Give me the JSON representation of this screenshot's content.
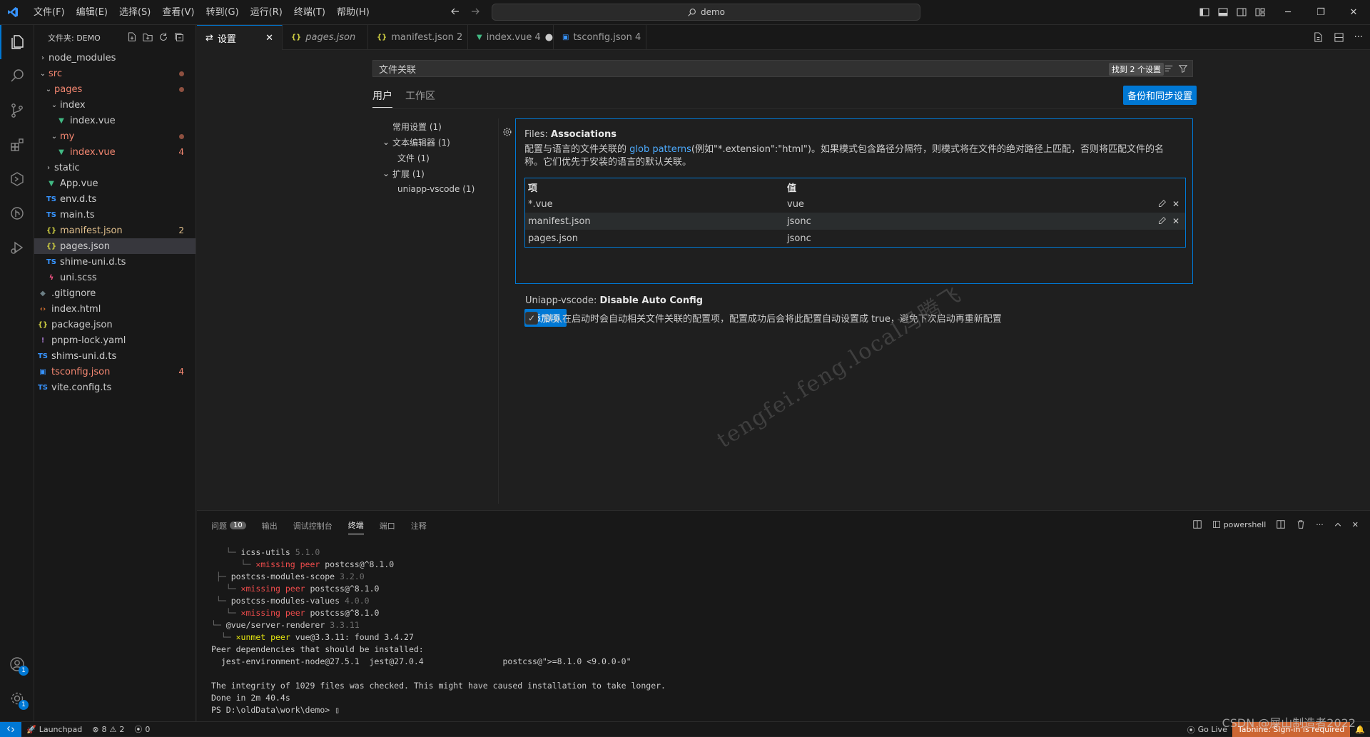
{
  "titlebar": {
    "menus": [
      "文件(F)",
      "编辑(E)",
      "选择(S)",
      "查看(V)",
      "转到(G)",
      "运行(R)",
      "终端(T)",
      "帮助(H)"
    ],
    "search_text": "demo"
  },
  "explorer": {
    "title": "文件夹: DEMO",
    "items": [
      {
        "label": "node_modules"
      },
      {
        "label": "src",
        "badge": ""
      },
      {
        "label": "pages"
      },
      {
        "label": "index"
      },
      {
        "label": "index.vue"
      },
      {
        "label": "my"
      },
      {
        "label": "index.vue",
        "badge": "4"
      },
      {
        "label": "static"
      },
      {
        "label": "App.vue"
      },
      {
        "label": "env.d.ts"
      },
      {
        "label": "main.ts"
      },
      {
        "label": "manifest.json",
        "badge": "2"
      },
      {
        "label": "pages.json"
      },
      {
        "label": "shime-uni.d.ts"
      },
      {
        "label": "uni.scss"
      },
      {
        "label": ".gitignore"
      },
      {
        "label": "index.html"
      },
      {
        "label": "package.json"
      },
      {
        "label": "pnpm-lock.yaml"
      },
      {
        "label": "shims-uni.d.ts"
      },
      {
        "label": "tsconfig.json",
        "badge": "4"
      },
      {
        "label": "vite.config.ts"
      }
    ]
  },
  "tabs": [
    {
      "label": "设置"
    },
    {
      "label": "pages.json"
    },
    {
      "label": "manifest.json 2"
    },
    {
      "label": "index.vue 4"
    },
    {
      "label": "tsconfig.json 4"
    }
  ],
  "settings": {
    "search_value": "文件关联",
    "search_count": "找到 2 个设置",
    "scope_user": "用户",
    "scope_workspace": "工作区",
    "sync_button": "备份和同步设置",
    "toc": [
      "常用设置 (1)",
      "文本编辑器 (1)",
      "文件 (1)",
      "扩展 (1)",
      "uniapp-vscode (1)"
    ],
    "assoc": {
      "category": "Files: ",
      "name": "Associations",
      "desc_before": "配置与语言的文件关联的 ",
      "desc_link": "glob patterns",
      "desc_after": "(例如\"*.extension\":\"html\")。如果模式包含路径分隔符，则模式将在文件的绝对路径上匹配，否则将匹配文件的名称。它们优先于安装的语言的默认关联。",
      "col_key": "项",
      "col_value": "值",
      "rows": [
        {
          "key": "*.vue",
          "value": "vue"
        },
        {
          "key": "manifest.json",
          "value": "jsonc"
        },
        {
          "key": "pages.json",
          "value": "jsonc"
        }
      ],
      "add_button": "添加项"
    },
    "uni": {
      "category": "Uniapp-vscode: ",
      "name": "Disable Auto Config",
      "checkbox_label": "默认在启动时会自动相关文件关联的配置项，配置成功后会将此配置自动设置成 true，避免下次启动再重新配置",
      "checked": true
    },
    "watermark": "tengfei.feng.local冯腾飞"
  },
  "panel": {
    "tabs": [
      {
        "label": "问题",
        "badge": "10"
      },
      {
        "label": "输出"
      },
      {
        "label": "调试控制台"
      },
      {
        "label": "终端"
      },
      {
        "label": "端口"
      },
      {
        "label": "注释"
      }
    ],
    "shell": "powershell",
    "terminal": [
      {
        "tree": "   └─ ",
        "text": "icss-utils ",
        "dim": "5.1.0"
      },
      {
        "tree": "      └─ ",
        "red": "✕missing peer ",
        "text": "postcss@^8.1.0"
      },
      {
        "tree": " ├─ ",
        "text": "postcss-modules-scope ",
        "dim": "3.2.0"
      },
      {
        "tree": "   └─ ",
        "red": "✕missing peer ",
        "text": "postcss@^8.1.0"
      },
      {
        "tree": " └─ ",
        "text": "postcss-modules-values ",
        "dim": "4.0.0"
      },
      {
        "tree": "   └─ ",
        "red": "✕missing peer ",
        "text": "postcss@^8.1.0"
      },
      {
        "tree": "└─ ",
        "text": "@vue/server-renderer ",
        "dim": "3.3.11"
      },
      {
        "tree": "  └─ ",
        "yel": "✕unmet peer ",
        "text": "vue@3.3.11: found 3.4.27"
      },
      {
        "tree": "",
        "text": "Peer dependencies that should be installed:"
      },
      {
        "tree": "",
        "text": "  jest-environment-node@27.5.1  jest@27.0.4                postcss@\">=8.1.0 <9.0.0-0\""
      },
      {
        "tree": "",
        "text": " "
      },
      {
        "tree": "",
        "text": "The integrity of 1029 files was checked. This might have caused installation to take longer."
      },
      {
        "tree": "",
        "text": "Done in 2m 40.4s"
      },
      {
        "tree": "",
        "text": "PS D:\\oldData\\work\\demo> ▯"
      }
    ]
  },
  "statusbar": {
    "launchpad": "Launchpad",
    "errors": "8",
    "warnings": "2",
    "ports": "0",
    "golive": "Go Live",
    "tabnine": "Tabnine: Sign-in is required"
  },
  "corner_watermark": "CSDN @屎山制造者2022",
  "colors": {
    "accent": "#0078d4",
    "error": "#f48771",
    "modified": "#e2c08d"
  }
}
